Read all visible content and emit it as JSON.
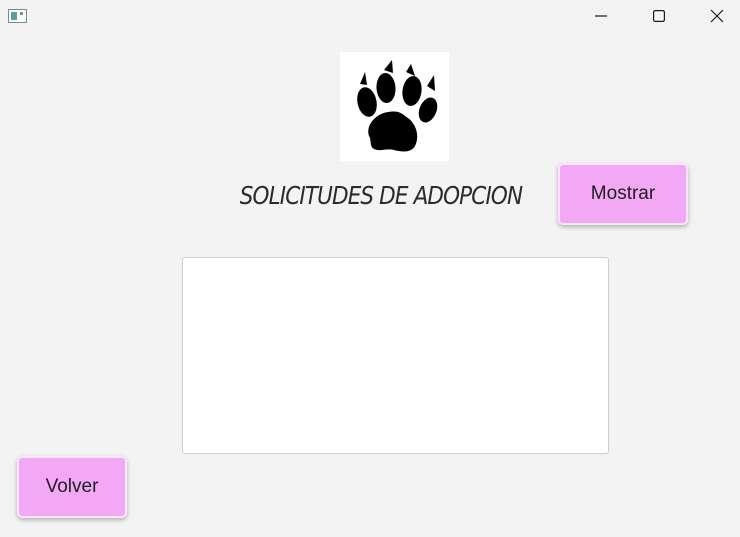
{
  "window": {
    "title": "",
    "controls": {
      "minimize_icon": "minimize-icon",
      "maximize_icon": "maximize-icon",
      "close_icon": "close-icon"
    }
  },
  "header": {
    "logo_icon": "paw-print-icon",
    "title": "SOLICITUDES DE ADOPCION"
  },
  "actions": {
    "show_label": "Mostrar",
    "back_label": "Volver"
  },
  "results": {
    "content": ""
  },
  "colors": {
    "background": "#f3f3f3",
    "button_fill": "#f3a8f5",
    "button_border": "#fbe4fc",
    "text": "#2b2b2b"
  }
}
